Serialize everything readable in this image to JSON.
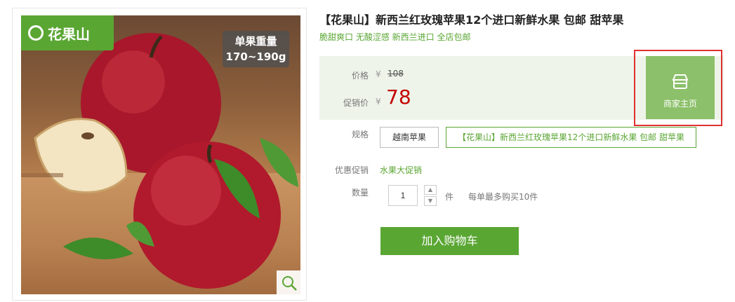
{
  "product_image": {
    "brand_logo_text": "花果山",
    "weight_badge_line1": "单果重量",
    "weight_badge_line2": "170~190g",
    "icons": [
      "magnifier-icon"
    ]
  },
  "product": {
    "title": "【花果山】新西兰红玫瑰苹果12个进口新鲜水果 包邮 甜苹果",
    "subtitle": "脆甜爽口 无酸涩感 新西兰进口 全店包邮"
  },
  "price": {
    "price_label": "价格",
    "currency": "¥",
    "original_price": "108",
    "promo_price_label": "促销价",
    "promo_price": "78"
  },
  "store": {
    "button_label": "商家主页",
    "icon": "store-icon"
  },
  "spec": {
    "label": "规格",
    "options": [
      "越南苹果",
      "【花果山】新西兰红玫瑰苹果12个进口新鲜水果 包邮 甜苹果"
    ]
  },
  "promotion": {
    "label": "优惠促销",
    "value": "水果大促销"
  },
  "quantity": {
    "label": "数量",
    "value": "1",
    "unit": "件",
    "limit_text": "每单最多购买10件"
  },
  "actions": {
    "add_to_cart": "加入购物车"
  },
  "colors": {
    "brand_green": "#5aa633",
    "price_red": "#c40000",
    "store_button_green": "#8cc06a",
    "highlight_red": "#e03030",
    "price_box_bg": "#eef4ea"
  }
}
